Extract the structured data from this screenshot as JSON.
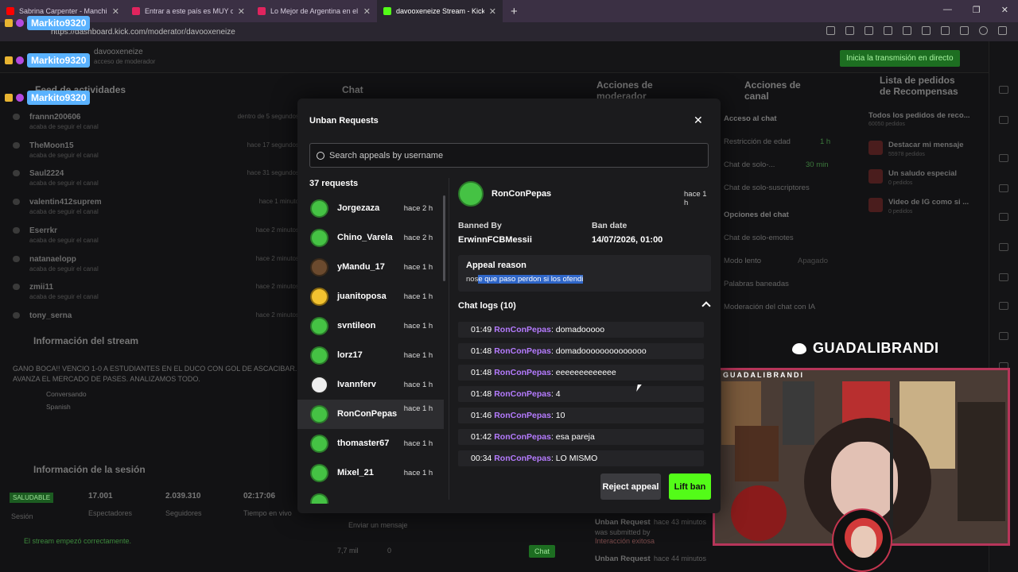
{
  "browser": {
    "tabs": [
      {
        "title": "Sabrina Carpenter - Manchild",
        "favicon_color": "#ff0000"
      },
      {
        "title": "Entrar a este país es MUY difícil y...",
        "favicon_color": "#e0245e"
      },
      {
        "title": "Lo Mejor de Argentina en el Mund...",
        "favicon_color": "#e0245e"
      },
      {
        "title": "davooxeneize Stream - Kick Dashb...",
        "favicon_color": "#53fc18",
        "active": true
      }
    ],
    "url": "https://dashboard.kick.com/moderator/davooxeneize"
  },
  "overlay_badges": [
    "Markito9320",
    "Markito9320",
    "Markito9320"
  ],
  "dashboard": {
    "channel": "davooxeneize",
    "channel_sub": "acceso de moderador",
    "go_live": "Inicia la transmisión en directo",
    "panels": {
      "activity": "Feed de actividades",
      "chat": "Chat",
      "mod_actions": "Acciones de moderador",
      "channel_actions": "Acciones de canal",
      "rewards": "Lista de pedidos de Recompensas"
    },
    "activity_feed": [
      {
        "name": "frannn200606",
        "desc": "acaba de seguir el canal",
        "time": "dentro de 5 segundos"
      },
      {
        "name": "TheMoon15",
        "desc": "acaba de seguir el canal",
        "time": "hace 17 segundos"
      },
      {
        "name": "Saul2224",
        "desc": "acaba de seguir el canal",
        "time": "hace 31 segundos"
      },
      {
        "name": "valentin412suprem",
        "desc": "acaba de seguir el canal",
        "time": "hace 1 minuto"
      },
      {
        "name": "Eserrkr",
        "desc": "acaba de seguir el canal",
        "time": "hace 2 minutos"
      },
      {
        "name": "natanaelopp",
        "desc": "acaba de seguir el canal",
        "time": "hace 2 minutos"
      },
      {
        "name": "zmii11",
        "desc": "acaba de seguir el canal",
        "time": "hace 2 minutos"
      },
      {
        "name": "tony_serna",
        "desc": "",
        "time": "hace 2 minutos"
      }
    ],
    "stream_info_title": "Información del stream",
    "stream_info_text": "GANO BOCA!! VENCIO 1-0 A ESTUDIANTES EN EL DUCO CON GOL DE ASCACIBAR. AVANZA EL MERCADO DE PASES. ANALIZAMOS TODO.",
    "stream_category": "Conversando",
    "stream_lang": "Spanish",
    "session_title": "Información de la sesión",
    "session": {
      "status": "SALUDABLE",
      "spectators": "17.001",
      "spectators_l": "Espectadores",
      "followers": "2.039.310",
      "followers_l": "Seguidores",
      "live_time": "02:17:06",
      "live_time_l": "Tiempo en vivo",
      "session_l": "Sesión"
    },
    "stream_ok": "El stream empezó correctamente.",
    "channel_actions": {
      "chat_access": "Acceso al chat",
      "age_restriction": "Restricción de edad",
      "age_value": "1 h",
      "followers_only": "Chat de solo-...",
      "followers_value": "30 min",
      "subs_only": "Chat de solo-suscriptores",
      "chat_options": "Opciones del chat",
      "emotes_only": "Chat de solo-emotes",
      "slow_mode": "Modo lento",
      "slow_value": "Apagado",
      "banned_words": "Palabras baneadas",
      "ai_mod": "Moderación del chat con IA"
    },
    "rewards": {
      "all": "Todos los pedidos de reco...",
      "all_count": "60050 pedidos",
      "items": [
        {
          "name": "Destacar mi mensaje",
          "count": "55978 pedidos"
        },
        {
          "name": "Un saludo especial",
          "count": "0 pedidos"
        },
        {
          "name": "Video de IG como si ...",
          "count": "0 pedidos"
        }
      ]
    },
    "mod_log": [
      {
        "title": "Unban Request",
        "time": "hace 43 minutos",
        "sub": "was submitted by"
      },
      {
        "title": "Interacción exitosa",
        "time": "",
        "sub": ""
      },
      {
        "title": "Unban Request",
        "time": "hace 44 minutos",
        "sub": ""
      }
    ],
    "chat_placeholder": "Enviar un mensaje",
    "chat_viewers": "7,7 mil",
    "chat_points": "0",
    "chat_button": "Chat"
  },
  "webcam": {
    "twitter_handle": "GUADALIBRANDI",
    "frame_label": "GUADALIBRANDI"
  },
  "modal": {
    "title": "Unban Requests",
    "search_placeholder": "Search appeals by username",
    "request_count": "37 requests",
    "requests": [
      {
        "name": "Jorgezaza",
        "time": "hace 2 h"
      },
      {
        "name": "Chino_Varela",
        "time": "hace 2 h"
      },
      {
        "name": "yMandu_17",
        "time": "hace 1 h"
      },
      {
        "name": "juanitoposa",
        "time": "hace 1 h"
      },
      {
        "name": "svntileon",
        "time": "hace 1 h"
      },
      {
        "name": "lorz17",
        "time": "hace 1 h"
      },
      {
        "name": "Ivannferv",
        "time": "hace 1 h"
      },
      {
        "name": "RonConPepas",
        "time": "hace 1 h",
        "selected": true
      },
      {
        "name": "thomaster67",
        "time": "hace 1 h"
      },
      {
        "name": "Mixel_21",
        "time": "hace 1 h"
      }
    ],
    "detail": {
      "username": "RonConPepas",
      "time": "hace 1 h",
      "banned_by_label": "Banned By",
      "banned_by": "ErwinnFCBMessii",
      "ban_date_label": "Ban date",
      "ban_date": "14/07/2026, 01:00",
      "appeal_label": "Appeal reason",
      "appeal_pre": "nos",
      "appeal_highlight": "e que paso perdon si los ofendi",
      "logs_label": "Chat logs (10)",
      "logs": [
        {
          "time": "01:49",
          "user": "RonConPepas",
          "msg": ": domadooooo"
        },
        {
          "time": "01:48",
          "user": "RonConPepas",
          "msg": ": domadoooooooooooooo"
        },
        {
          "time": "01:48",
          "user": "RonConPepas",
          "msg": ": eeeeeeeeeeeee"
        },
        {
          "time": "01:48",
          "user": "RonConPepas",
          "msg": ": 4"
        },
        {
          "time": "01:46",
          "user": "RonConPepas",
          "msg": ": 10"
        },
        {
          "time": "01:42",
          "user": "RonConPepas",
          "msg": ": esa pareja"
        },
        {
          "time": "00:34",
          "user": "RonConPepas",
          "msg": ": LO MISMO"
        }
      ]
    },
    "reject_label": "Reject appeal",
    "lift_label": "Lift ban",
    "accent": "#53fc18"
  }
}
